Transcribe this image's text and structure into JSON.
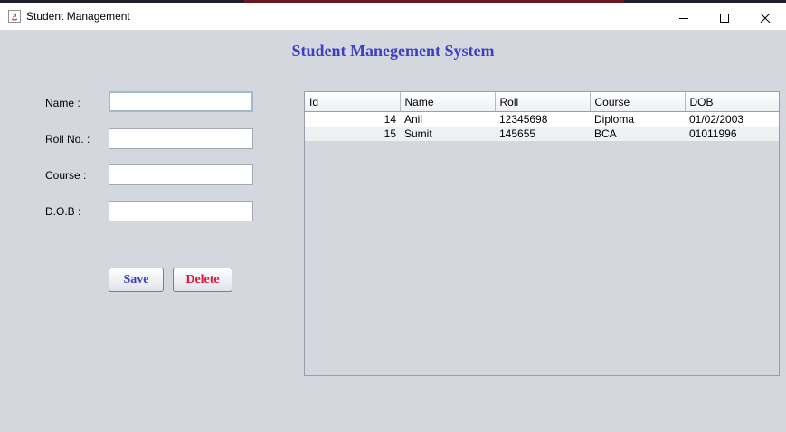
{
  "window": {
    "title": "Student Management",
    "minimize_label": "—",
    "maximize_label": "☐",
    "close_label": "✕"
  },
  "heading": "Student Manegement System",
  "form": {
    "name_label": "Name :",
    "roll_label": "Roll No. :",
    "course_label": "Course :",
    "dob_label": "D.O.B :",
    "name_value": "",
    "roll_value": "",
    "course_value": "",
    "dob_value": ""
  },
  "buttons": {
    "save": "Save",
    "delete": "Delete"
  },
  "table": {
    "columns": [
      "Id",
      "Name",
      "Roll",
      "Course",
      "DOB"
    ],
    "rows": [
      [
        "14",
        "Anil",
        "12345698",
        "Diploma",
        "01/02/2003"
      ],
      [
        "15",
        "Sumit",
        "145655",
        "BCA",
        "01011996"
      ]
    ]
  },
  "colors": {
    "heading": "#3a3fc4",
    "save_text": "#3a3fc4",
    "delete_text": "#e0163a",
    "background": "#d4d7de"
  }
}
